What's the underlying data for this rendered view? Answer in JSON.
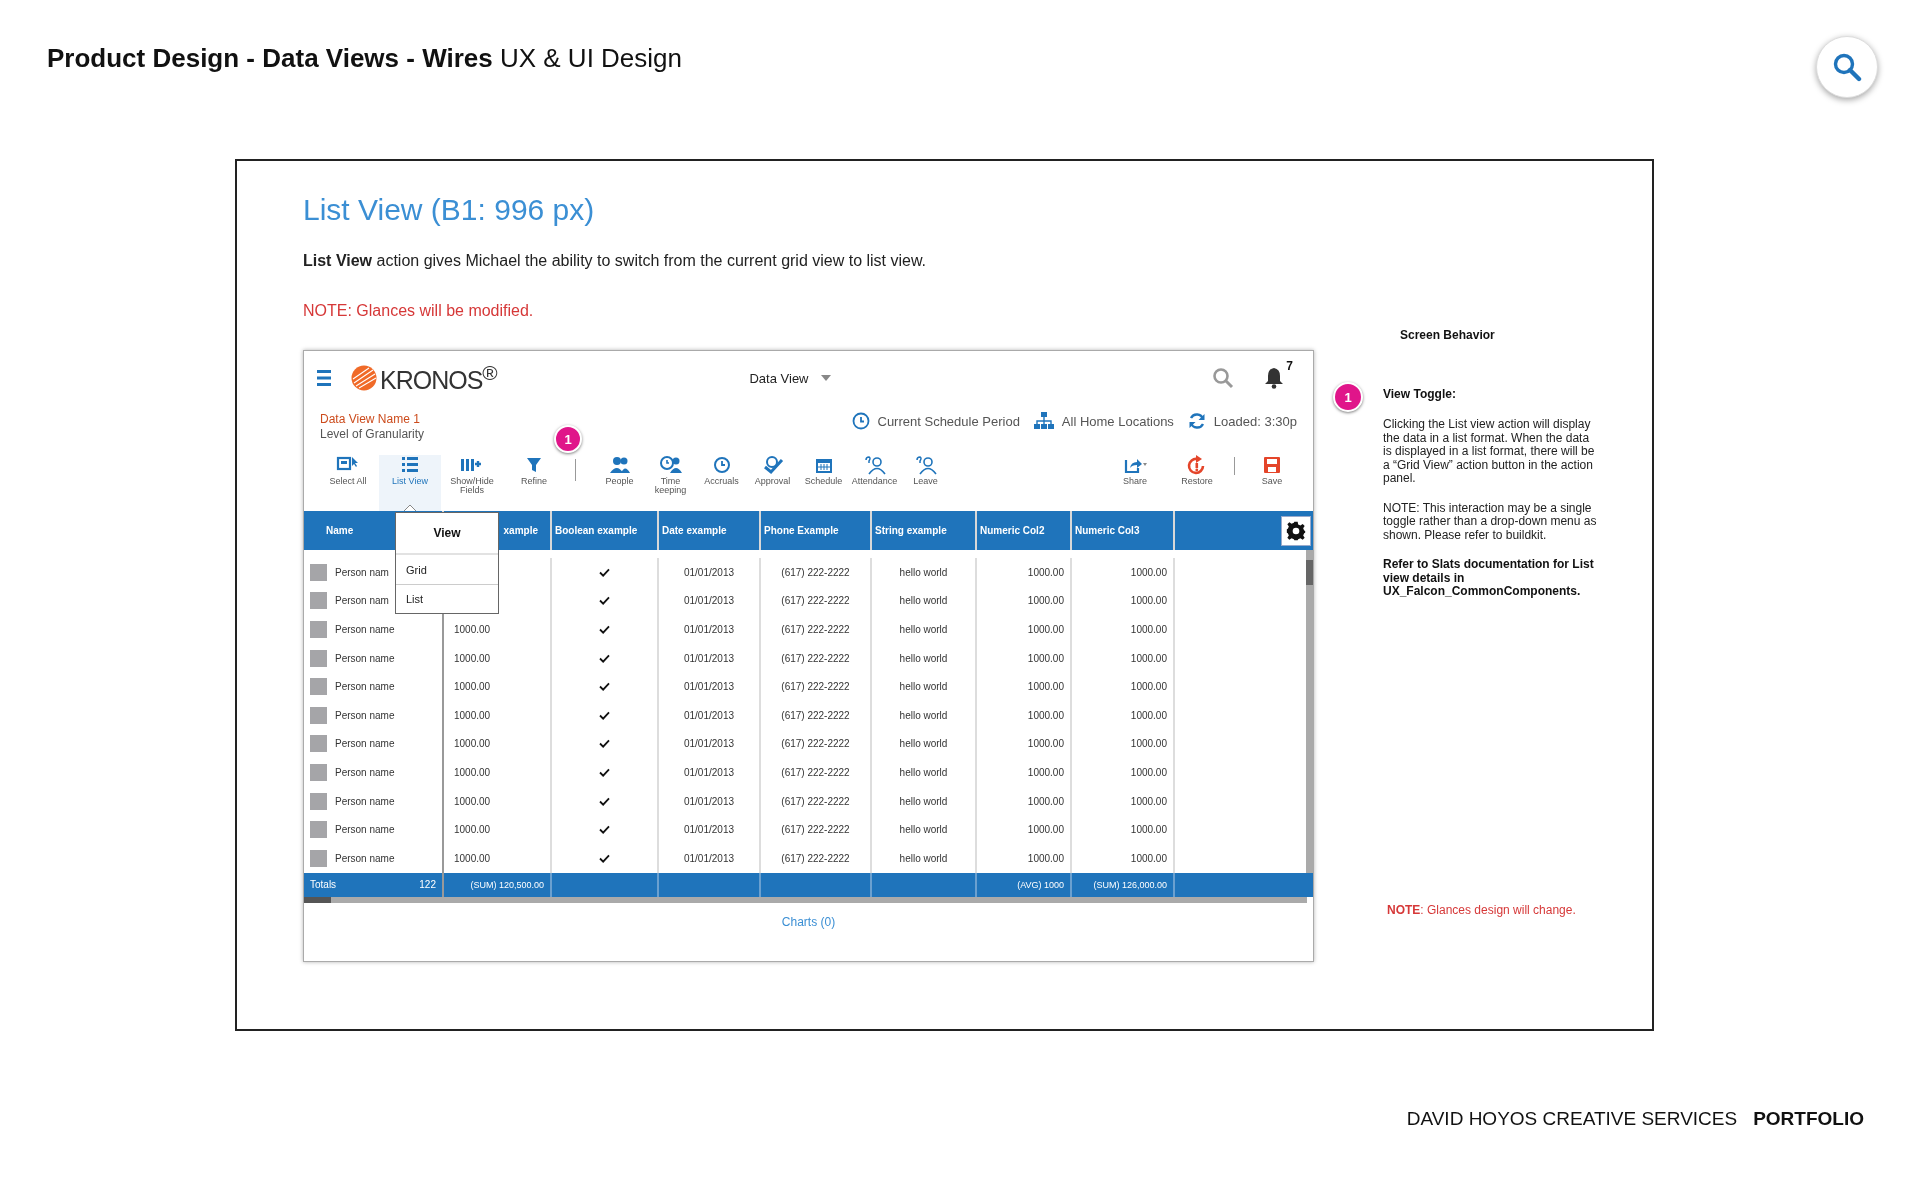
{
  "header": {
    "title": "**Product Design - Data Views - Wires** UX & UI Design"
  },
  "slide": {
    "heading": "List View (B1: 996 px)",
    "description": "**List View**  action gives Michael the ability to switch from the current grid view to list view.",
    "note": "NOTE: Glances will be modified."
  },
  "app": {
    "logo": "KRONOS$^{®}$",
    "view_selector": "Data View",
    "notification_count": "7",
    "data_view_name": "Data View Name 1",
    "granularity": "Level of Granularity",
    "filters": [
      {
        "kind": "period",
        "label": "Current Schedule Period"
      },
      {
        "kind": "location",
        "label": "All Home Locations"
      },
      {
        "kind": "loaded",
        "label": "Loaded: 3:30p"
      }
    ],
    "view_actions": [
      {
        "kind": "select-all",
        "label": "Select All",
        "selected": false
      },
      {
        "kind": "list",
        "label": "List View",
        "selected": true
      },
      {
        "kind": "columns",
        "label": "Show/Hide\nFields",
        "selected": false
      },
      {
        "kind": "filter",
        "label": "Refine",
        "selected": false
      }
    ],
    "callout_badge": "1",
    "data_actions": [
      {
        "kind": "people",
        "label": "People"
      },
      {
        "kind": "timekeeping",
        "label": "Time\nkeeping"
      },
      {
        "kind": "accruals",
        "label": "Accruals"
      },
      {
        "kind": "approval",
        "label": "Approval"
      },
      {
        "kind": "schedule",
        "label": "Schedule"
      },
      {
        "kind": "attendance",
        "label": "Attendance"
      },
      {
        "kind": "leave",
        "label": "Leave"
      }
    ],
    "page_actions": [
      {
        "kind": "share",
        "label": "Share"
      },
      {
        "kind": "restore",
        "label": "Restore"
      },
      {
        "kind": "save",
        "label": "Save"
      }
    ],
    "table": {
      "columns": [
        "Name",
        "xample",
        "Boolean example",
        "Date example",
        "Phone Example",
        "String example",
        "Numeric Col2",
        "Numeric Col3"
      ],
      "rows": [
        {
          "name": "Person nam",
          "checked": true,
          "date": "01/01/2013",
          "phone": "(617) 222-2222",
          "string": "hello world",
          "num2": "1000.00",
          "num3": "1000.00"
        },
        {
          "name": "Person nam",
          "checked": true,
          "date": "01/01/2013",
          "phone": "(617) 222-2222",
          "string": "hello world",
          "num2": "1000.00",
          "num3": "1000.00"
        },
        {
          "name": "Person name",
          "col2": "1000.00",
          "checked": true,
          "date": "01/01/2013",
          "phone": "(617) 222-2222",
          "string": "hello world",
          "num2": "1000.00",
          "num3": "1000.00"
        },
        {
          "name": "Person name",
          "col2": "1000.00",
          "checked": true,
          "date": "01/01/2013",
          "phone": "(617) 222-2222",
          "string": "hello world",
          "num2": "1000.00",
          "num3": "1000.00"
        },
        {
          "name": "Person name",
          "col2": "1000.00",
          "checked": true,
          "date": "01/01/2013",
          "phone": "(617) 222-2222",
          "string": "hello world",
          "num2": "1000.00",
          "num3": "1000.00"
        },
        {
          "name": "Person name",
          "col2": "1000.00",
          "checked": true,
          "date": "01/01/2013",
          "phone": "(617) 222-2222",
          "string": "hello world",
          "num2": "1000.00",
          "num3": "1000.00"
        },
        {
          "name": "Person name",
          "col2": "1000.00",
          "checked": true,
          "date": "01/01/2013",
          "phone": "(617) 222-2222",
          "string": "hello world",
          "num2": "1000.00",
          "num3": "1000.00"
        },
        {
          "name": "Person name",
          "col2": "1000.00",
          "checked": true,
          "date": "01/01/2013",
          "phone": "(617) 222-2222",
          "string": "hello world",
          "num2": "1000.00",
          "num3": "1000.00"
        },
        {
          "name": "Person name",
          "col2": "1000.00",
          "checked": true,
          "date": "01/01/2013",
          "phone": "(617) 222-2222",
          "string": "hello world",
          "num2": "1000.00",
          "num3": "1000.00"
        },
        {
          "name": "Person name",
          "col2": "1000.00",
          "checked": true,
          "date": "01/01/2013",
          "phone": "(617) 222-2222",
          "string": "hello world",
          "num2": "1000.00",
          "num3": "1000.00"
        },
        {
          "name": "Person name",
          "col2": "1000.00",
          "checked": true,
          "date": "01/01/2013",
          "phone": "(617) 222-2222",
          "string": "hello world",
          "num2": "1000.00",
          "num3": "1000.00"
        }
      ],
      "totals": {
        "label": "Totals",
        "count": "122",
        "col2": "(SUM)  120,500.00",
        "num2": "(AVG) 1000",
        "num3": "(SUM)  126,000.00"
      }
    },
    "view_menu": {
      "title": "View",
      "items": [
        "Grid",
        "List"
      ]
    },
    "charts_link": "Charts (0)"
  },
  "screen_behavior": {
    "title": "Screen Behavior",
    "badge": "1",
    "heading": "View Toggle:",
    "paragraphs": [
      "Clicking the List view action will display the data in a list format. When the data is displayed in a list format, there will be a “Grid View” action button in the action panel.",
      "NOTE: This interaction may be a single toggle rather than a drop-down menu as shown. Please refer to buildkit."
    ],
    "reference": "Refer to Slats documentation for List view details in UX_Falcon_CommonComponents.",
    "note": "**NOTE**: Glances design will change."
  },
  "footer": {
    "studio": "DAVID HOYOS CREATIVE SERVICES",
    "section": "PORTFOLIO"
  }
}
